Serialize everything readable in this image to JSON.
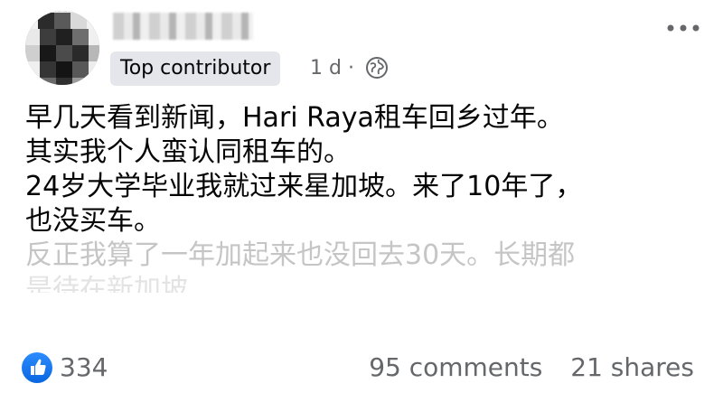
{
  "post": {
    "badge": "Top contributor",
    "time": "1 d",
    "separator": "·",
    "lines": [
      "早几天看到新闻，Hari Raya租车回乡过年。",
      "其实我个人蛮认同租车的。",
      "24岁大学毕业我就过来星加坡。来了10年了，",
      "也没买车。",
      "反正我算了一年加起来也没回去30天。长期都",
      "是待在新加坡"
    ]
  },
  "footer": {
    "likes": "334",
    "comments": "95 comments",
    "shares": "21 shares"
  },
  "icons": {
    "audience": "globe-icon",
    "more": "more-options-icon",
    "reaction": "like-icon"
  },
  "colors": {
    "badge_bg": "#e4e6eb",
    "secondary_text": "#65676b",
    "like_blue": "#1877f2"
  }
}
